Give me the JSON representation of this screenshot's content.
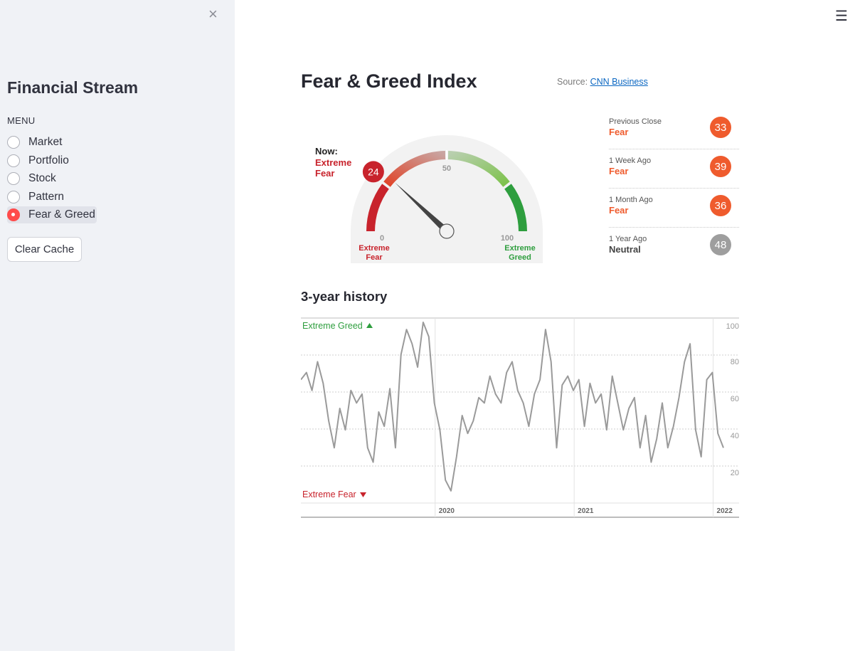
{
  "sidebar": {
    "title": "Financial Stream",
    "menu_label": "MENU",
    "menu_items": [
      "Market",
      "Portfolio",
      "Stock",
      "Pattern",
      "Fear & Greed"
    ],
    "selected": "Fear & Greed",
    "clear_cache_label": "Clear Cache",
    "close_icon": "×"
  },
  "header": {
    "menu_icon": "☰"
  },
  "main": {
    "title": "Fear & Greed Index",
    "source_prefix": "Source:",
    "source_link": "CNN Business"
  },
  "gauge": {
    "now_label": "Now:",
    "now_status_line1": "Extreme",
    "now_status_line2": "Fear",
    "now_value": 24,
    "tick_0": "0",
    "tick_50": "50",
    "tick_100": "100",
    "left_label_line1": "Extreme",
    "left_label_line2": "Fear",
    "right_label_line1": "Extreme",
    "right_label_line2": "Greed",
    "colors": {
      "fear": "#c8232c",
      "greed": "#2e9e3e",
      "neutral": "#a0a0a0",
      "orange": "#ef5b2d"
    }
  },
  "history": [
    {
      "label": "Previous Close",
      "status": "Fear",
      "value": "33",
      "color": "#ef5b2d"
    },
    {
      "label": "1 Week Ago",
      "status": "Fear",
      "value": "39",
      "color": "#ef5b2d"
    },
    {
      "label": "1 Month Ago",
      "status": "Fear",
      "value": "36",
      "color": "#ef5b2d"
    },
    {
      "label": "1 Year Ago",
      "status": "Neutral",
      "value": "48",
      "color": "#9e9e9e"
    }
  ],
  "history_title": "3-year history",
  "chart_data": {
    "type": "line",
    "title": "3-year history",
    "top_label": "Extreme Greed",
    "bottom_label": "Extreme Fear",
    "ylim": [
      0,
      100
    ],
    "y_ticks": [
      20,
      40,
      60,
      80,
      100
    ],
    "x_labels": [
      "2020",
      "2021",
      "2022"
    ],
    "grid": true,
    "series": [
      {
        "color": "#9a9a9a",
        "x": [
          2019.08,
          2019.12,
          2019.16,
          2019.2,
          2019.24,
          2019.28,
          2019.32,
          2019.36,
          2019.4,
          2019.44,
          2019.48,
          2019.52,
          2019.56,
          2019.6,
          2019.64,
          2019.68,
          2019.72,
          2019.76,
          2019.8,
          2019.84,
          2019.88,
          2019.92,
          2019.96,
          2020.0,
          2020.04,
          2020.08,
          2020.12,
          2020.16,
          2020.2,
          2020.24,
          2020.28,
          2020.32,
          2020.36,
          2020.4,
          2020.44,
          2020.48,
          2020.52,
          2020.56,
          2020.6,
          2020.64,
          2020.68,
          2020.72,
          2020.76,
          2020.8,
          2020.84,
          2020.88,
          2020.92,
          2020.96,
          2021.0,
          2021.04,
          2021.08,
          2021.12,
          2021.16,
          2021.2,
          2021.24,
          2021.28,
          2021.32,
          2021.36,
          2021.4,
          2021.44,
          2021.48,
          2021.52,
          2021.56,
          2021.6,
          2021.64,
          2021.68,
          2021.72,
          2021.76,
          2021.8,
          2021.84,
          2021.88,
          2021.92,
          2021.96,
          2022.0,
          2022.04,
          2022.08,
          2022.12
        ],
        "y": [
          68,
          72,
          62,
          78,
          66,
          45,
          30,
          52,
          40,
          62,
          55,
          60,
          30,
          22,
          50,
          42,
          63,
          30,
          82,
          96,
          88,
          75,
          100,
          92,
          55,
          40,
          12,
          6,
          25,
          48,
          38,
          45,
          58,
          55,
          70,
          60,
          55,
          72,
          78,
          62,
          55,
          42,
          60,
          68,
          96,
          78,
          30,
          65,
          70,
          62,
          68,
          42,
          66,
          55,
          60,
          40,
          70,
          55,
          40,
          52,
          58,
          30,
          48,
          22,
          35,
          55,
          30,
          42,
          58,
          78,
          88,
          40,
          25,
          68,
          72,
          38,
          30
        ]
      }
    ]
  }
}
